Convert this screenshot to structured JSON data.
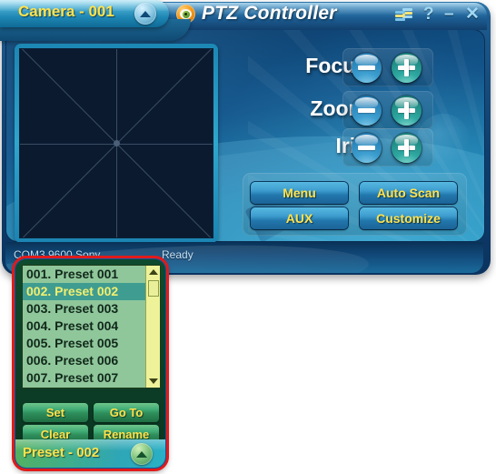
{
  "app": {
    "title": "PTZ Controller",
    "icon": "eye-logo-icon"
  },
  "titlebar": {
    "settings_icon": "stacked-windows-icon",
    "help_label": "?",
    "minimize_label": "–",
    "close_label": "✕"
  },
  "camera": {
    "title": "Camera - 001",
    "collapse_icon": "chevron-up-icon"
  },
  "pan_tilt": {
    "name": "pan-tilt-pad"
  },
  "lens": {
    "rows": [
      {
        "label": "Focus",
        "minus": "−",
        "plus": "+"
      },
      {
        "label": "Zoom",
        "minus": "−",
        "plus": "+"
      },
      {
        "label": "Iris",
        "minus": "−",
        "plus": "+"
      }
    ]
  },
  "actions": {
    "menu": "Menu",
    "auto_scan": "Auto Scan",
    "aux": "AUX",
    "customize": "Customize"
  },
  "status": {
    "port": "COM3 9600 Sony",
    "state": "Ready"
  },
  "presets": {
    "items": [
      {
        "label": "001. Preset 001",
        "selected": false
      },
      {
        "label": "002. Preset 002",
        "selected": true
      },
      {
        "label": "003. Preset 003",
        "selected": false
      },
      {
        "label": "004. Preset 004",
        "selected": false
      },
      {
        "label": "005. Preset 005",
        "selected": false
      },
      {
        "label": "006. Preset 006",
        "selected": false
      },
      {
        "label": "007. Preset 007",
        "selected": false
      }
    ],
    "buttons": {
      "set": "Set",
      "go_to": "Go To",
      "clear": "Clear",
      "rename": "Rename"
    },
    "footer_label": "Preset - 002",
    "collapse_icon": "chevron-up-icon"
  },
  "colors": {
    "accent_yellow": "#ffe34d",
    "window_blue": "#1b7fae",
    "list_green": "#8fc79b",
    "selection_teal": "#3f9c91",
    "highlight_red": "#e01b1b"
  }
}
